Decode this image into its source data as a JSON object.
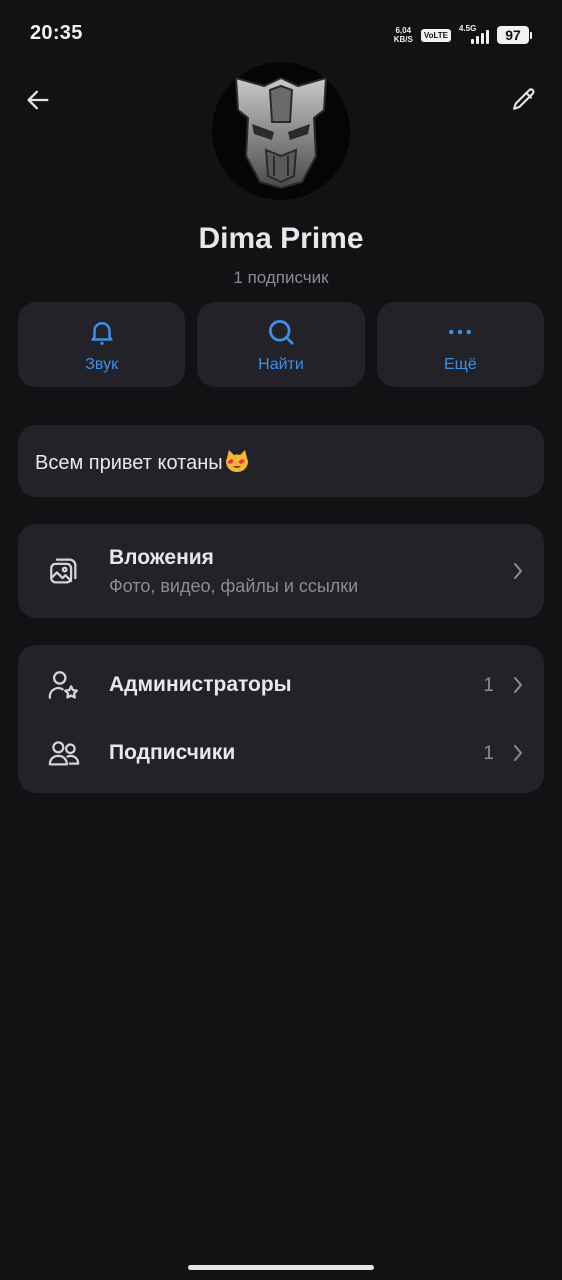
{
  "status_bar": {
    "time": "20:35",
    "net_speed_value": "6,04",
    "net_speed_unit": "KB/S",
    "volte": "VoLTE",
    "network": "4.5G",
    "battery": "97"
  },
  "header": {
    "back_icon": "arrow-left-icon",
    "edit_icon": "pencil-icon"
  },
  "profile": {
    "name": "Dima Prime",
    "subscribers": "1 подписчик"
  },
  "actions": [
    {
      "label": "Звук",
      "icon": "bell-icon"
    },
    {
      "label": "Найти",
      "icon": "search-icon"
    },
    {
      "label": "Ещё",
      "icon": "more-dots-icon"
    }
  ],
  "bio": {
    "text": "Всем привет котаны"
  },
  "media": {
    "title": "Вложения",
    "subtitle": "Фото, видео, файлы и ссылки"
  },
  "people": [
    {
      "title": "Администраторы",
      "count": "1"
    },
    {
      "title": "Подписчики",
      "count": "1"
    }
  ],
  "colors": {
    "background": "#121214",
    "card": "#222228",
    "accent": "#3d8fe8",
    "text_primary": "#e8e8ec",
    "text_secondary": "#8c8c94"
  }
}
